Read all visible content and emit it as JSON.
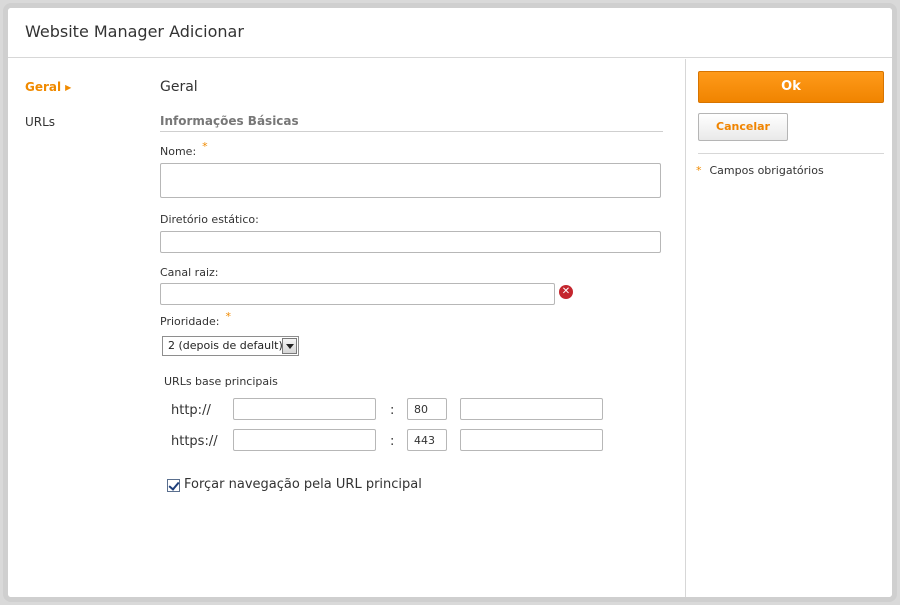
{
  "window": {
    "title": "Website Manager Adicionar"
  },
  "nav": {
    "items": [
      {
        "label": "Geral",
        "active": true
      },
      {
        "label": "URLs",
        "active": false
      }
    ]
  },
  "section": {
    "title": "Geral",
    "subsection": "Informações Básicas"
  },
  "form": {
    "nome": {
      "label": "Nome:",
      "required": true,
      "value": ""
    },
    "diretorio": {
      "label": "Diretório estático:",
      "value": ""
    },
    "canal": {
      "label": "Canal raiz:",
      "value": ""
    },
    "prioridade": {
      "label": "Prioridade:",
      "required": true,
      "selected": "2 (depois de default)"
    },
    "required_mark": "*"
  },
  "urls": {
    "heading": "URLs base principais",
    "rows": [
      {
        "protocol": "http://",
        "host": "",
        "separator": ":",
        "port": "80",
        "path": ""
      },
      {
        "protocol": "https://",
        "host": "",
        "separator": ":",
        "port": "443",
        "path": ""
      }
    ]
  },
  "force_nav": {
    "label": "Forçar navegação pela URL principal",
    "checked": true
  },
  "actions": {
    "ok_label": "Ok",
    "cancel_label": "Cancelar",
    "required_legend": "Campos obrigatórios",
    "legend_mark": "*"
  },
  "colors": {
    "accent": "#f08a00",
    "error": "#c4262e",
    "border": "#cfcfcf"
  },
  "icons": {
    "nav_active": "right-triangle-icon",
    "clear": "close-circle-icon",
    "dropdown": "chevron-down-icon",
    "checkbox": "checkmark-icon"
  }
}
